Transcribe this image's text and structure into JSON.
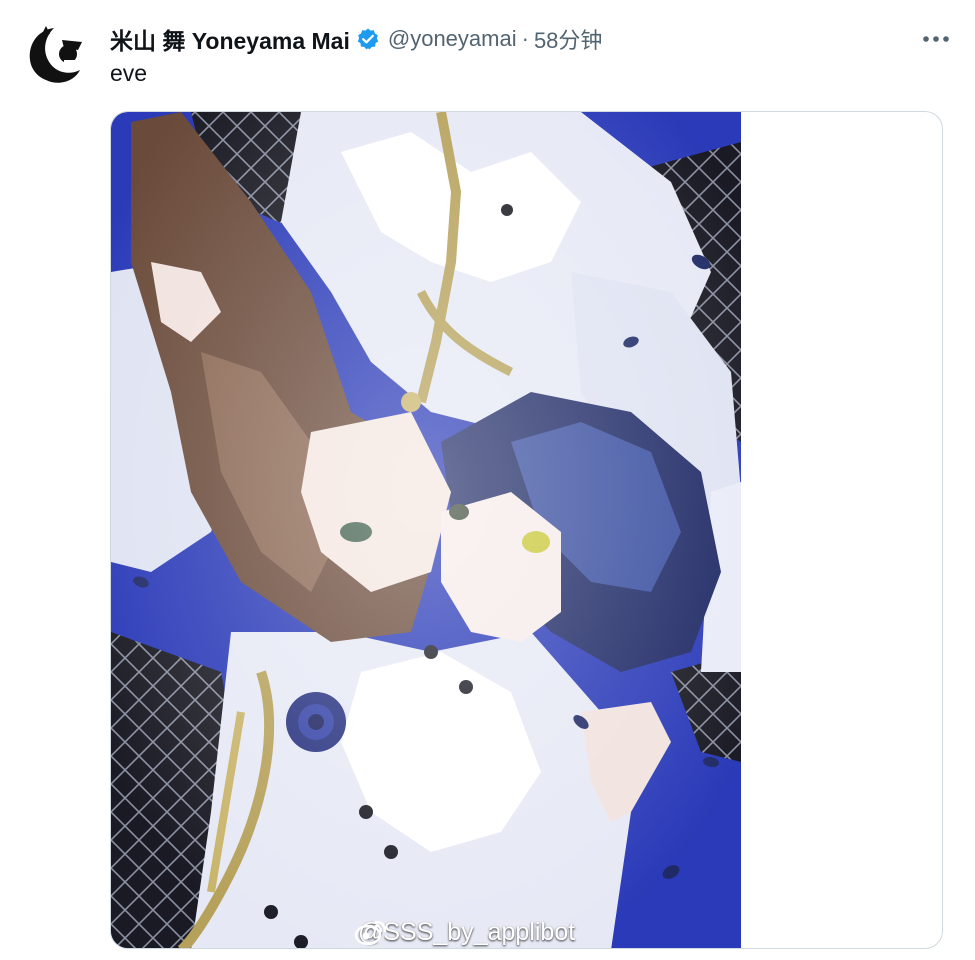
{
  "tweet": {
    "display_name": "米山 舞 Yoneyama Mai",
    "handle": "@yoneyamai",
    "separator": "·",
    "time": "58分钟",
    "text": "eve",
    "watermark": "@SSS_by_applibot"
  },
  "icons": {
    "verified": "verified-badge-icon",
    "more": "more-horizontal-icon",
    "watermark": "weibo-logo-icon"
  },
  "colors": {
    "verified": "#1d9bf0",
    "handle": "#536471",
    "illustration_blue": "#2a3ab8",
    "border": "#cfd9de"
  }
}
